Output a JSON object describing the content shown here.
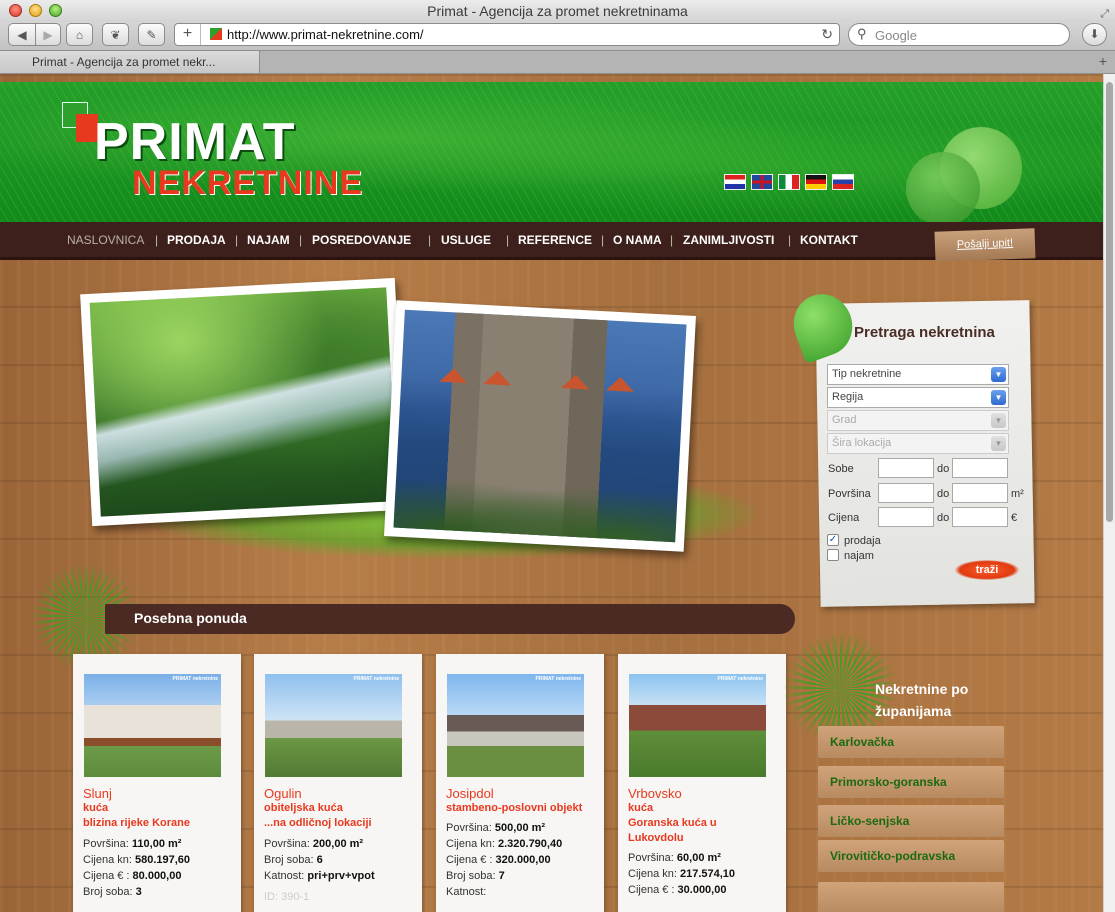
{
  "browser": {
    "window_title": "Primat - Agencija za promet nekretninama",
    "url": "http://www.primat-nekretnine.com/",
    "search_placeholder": "Google",
    "tab_title": "Primat - Agencija za promet nekr..."
  },
  "logo": {
    "line1": "PRIMAT",
    "line2": "NEKRETNINE"
  },
  "languages": [
    "hr-flag-icon",
    "en-flag-icon",
    "it-flag-icon",
    "de-flag-icon",
    "ru-flag-icon"
  ],
  "nav": {
    "items": [
      "NASLOVNICA",
      "PRODAJA",
      "NAJAM",
      "POSREDOVANJE",
      "USLUGE",
      "REFERENCE",
      "O NAMA",
      "ZANIMLJIVOSTI",
      "KONTAKT"
    ],
    "send_inquiry": "Pošalji upit!"
  },
  "search": {
    "title": "Pretraga nekretnina",
    "selects": [
      "Tip nekretnine",
      "Regija",
      "Grad",
      "Šira lokacija"
    ],
    "labels": {
      "rooms": "Sobe",
      "area": "Površina",
      "price": "Cijena",
      "to": "do",
      "area_unit": "m²",
      "price_unit": "€"
    },
    "checkboxes": {
      "sale": "prodaja",
      "rent": "najam"
    },
    "submit": "traži"
  },
  "offers": {
    "title": "Posebna ponuda",
    "watermark": "PRIMAT nekretnine",
    "cards": [
      {
        "city": "Slunj",
        "type": "kuća",
        "desc": "blizina rijeke Korane",
        "lines": [
          {
            "label": "Površina: ",
            "value": "110,00 m²"
          },
          {
            "label": "Cijena kn: ",
            "value": "580.197,60"
          },
          {
            "label": "Cijena € : ",
            "value": "80.000,00"
          },
          {
            "label": "Broj soba: ",
            "value": "3"
          }
        ]
      },
      {
        "city": "Ogulin",
        "type": "obiteljska kuća",
        "desc": "...na odličnoj lokaciji",
        "lines": [
          {
            "label": "Površina: ",
            "value": "200,00 m²"
          },
          {
            "label": "Broj soba: ",
            "value": "6"
          },
          {
            "label": "Katnost: ",
            "value": "pri+prv+vpot"
          }
        ],
        "id": "ID: 390-1"
      },
      {
        "city": "Josipdol",
        "type": "stambeno-poslovni objekt",
        "desc": "",
        "lines": [
          {
            "label": "Površina: ",
            "value": "500,00 m²"
          },
          {
            "label": "Cijena kn: ",
            "value": "2.320.790,40"
          },
          {
            "label": "Cijena € : ",
            "value": "320.000,00"
          },
          {
            "label": "Broj soba: ",
            "value": "7"
          },
          {
            "label": "Katnost: ",
            "value": ""
          }
        ]
      },
      {
        "city": "Vrbovsko",
        "type": "kuća",
        "desc": "Goranska kuća u Lukovdolu",
        "lines": [
          {
            "label": "Površina: ",
            "value": "60,00 m²"
          },
          {
            "label": "Cijena kn: ",
            "value": "217.574,10"
          },
          {
            "label": "Cijena € : ",
            "value": "30.000,00"
          }
        ]
      }
    ]
  },
  "counties": {
    "title": "Nekretnine po županijama",
    "items": [
      "Karlovačka",
      "Primorsko-goranska",
      "Ličko-senjska",
      "Virovitičko-podravska"
    ]
  },
  "colors": {
    "brand_green": "#1a8f22",
    "brand_red": "#e8391f",
    "nav_brown": "#3d201b"
  }
}
